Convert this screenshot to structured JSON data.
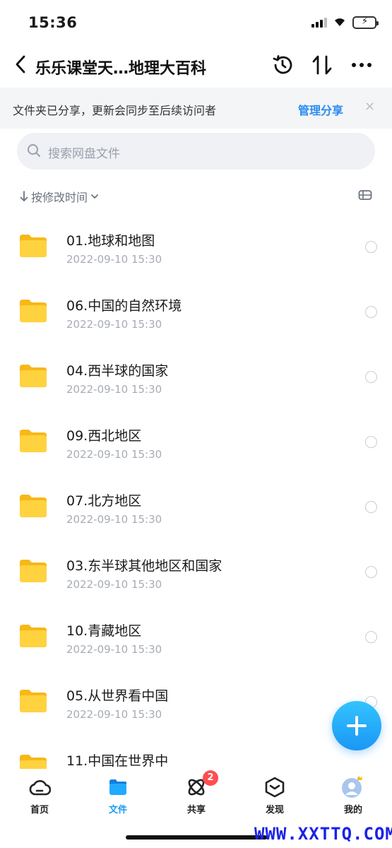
{
  "status_bar": {
    "time": "15:36"
  },
  "nav": {
    "title": "乐乐课堂天…地理大百科"
  },
  "share_banner": {
    "text": "文件夹已分享，更新会同步至后续访问者",
    "manage_label": "管理分享",
    "close_glyph": "×"
  },
  "search": {
    "placeholder": "搜索网盘文件"
  },
  "sort": {
    "label": "按修改时间"
  },
  "files": [
    {
      "name": "01.地球和地图",
      "date": "2022-09-10 15:30"
    },
    {
      "name": "06.中国的自然环境",
      "date": "2022-09-10 15:30"
    },
    {
      "name": "04.西半球的国家",
      "date": "2022-09-10 15:30"
    },
    {
      "name": "09.西北地区",
      "date": "2022-09-10 15:30"
    },
    {
      "name": "07.北方地区",
      "date": "2022-09-10 15:30"
    },
    {
      "name": "03.东半球其他地区和国家",
      "date": "2022-09-10 15:30"
    },
    {
      "name": "10.青藏地区",
      "date": "2022-09-10 15:30"
    },
    {
      "name": "05.从世界看中国",
      "date": "2022-09-10 15:30"
    },
    {
      "name": "11.中国在世界中",
      "date": ""
    }
  ],
  "tab_bar": {
    "items": [
      {
        "label": "首页",
        "icon": "cloud-home-icon",
        "active": false
      },
      {
        "label": "文件",
        "icon": "folder-icon",
        "active": true
      },
      {
        "label": "共享",
        "icon": "share-orbit-icon",
        "active": false,
        "badge": "2"
      },
      {
        "label": "发现",
        "icon": "cube-icon",
        "active": false
      },
      {
        "label": "我的",
        "icon": "avatar-icon",
        "active": false
      }
    ]
  },
  "watermark": "WWW.XXTTQ.COM",
  "colors": {
    "accent": "#2a8cf0",
    "fab": "#1a97f5",
    "folder": "#ffc92e",
    "badge": "#ff4d4f"
  }
}
